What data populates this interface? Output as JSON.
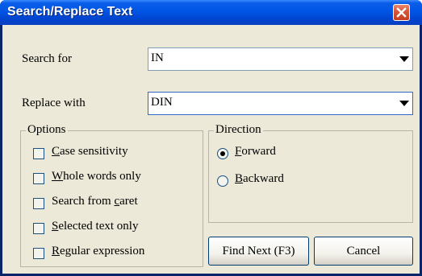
{
  "title": "Search/Replace Text",
  "search": {
    "label": "Search for",
    "value": "IN"
  },
  "replace": {
    "label": "Replace with",
    "value": "DIN"
  },
  "options": {
    "legend": "Options",
    "items": [
      {
        "pre": "",
        "key": "C",
        "post": "ase sensitivity",
        "checked": false
      },
      {
        "pre": "",
        "key": "W",
        "post": "hole words only",
        "checked": false
      },
      {
        "pre": "Search from ",
        "key": "c",
        "post": "aret",
        "checked": false
      },
      {
        "pre": "",
        "key": "S",
        "post": "elected text only",
        "checked": false
      },
      {
        "pre": "",
        "key": "R",
        "post": "egular expression",
        "checked": false
      }
    ]
  },
  "direction": {
    "legend": "Direction",
    "forward": {
      "key": "F",
      "post": "orward",
      "selected": true
    },
    "backward": {
      "key": "B",
      "post": "ackward",
      "selected": false
    }
  },
  "buttons": {
    "find_next": "Find Next (F3)",
    "cancel": "Cancel"
  }
}
